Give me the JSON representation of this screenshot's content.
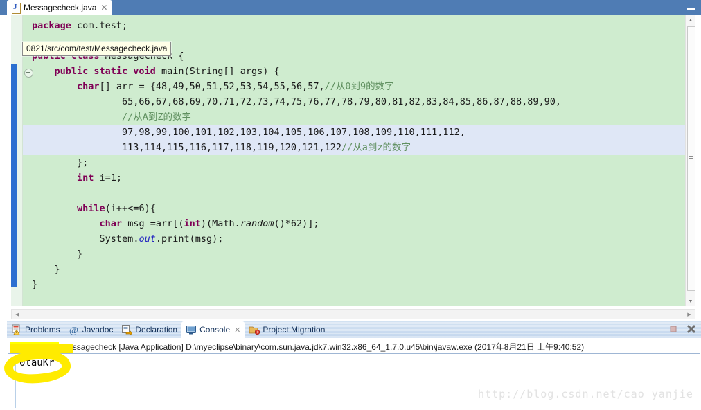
{
  "window": {
    "minimize_label": "–"
  },
  "editor": {
    "tab": {
      "icon": "java-file-icon",
      "label": "Messagecheck.java",
      "close": "✕"
    },
    "tooltip": "0821/src/com/test/Messagecheck.java",
    "code_lines": [
      {
        "indent": 0,
        "parts": [
          {
            "t": "kw",
            "s": "package"
          },
          {
            "t": "",
            "s": " com.test;"
          }
        ]
      },
      {
        "indent": 0,
        "parts": []
      },
      {
        "indent": 0,
        "parts": [
          {
            "t": "kw",
            "s": "public class"
          },
          {
            "t": "",
            "s": " Messagecheck {"
          }
        ]
      },
      {
        "indent": 1,
        "parts": [
          {
            "t": "kw",
            "s": "public static void"
          },
          {
            "t": "",
            "s": " main(String[] args) {"
          }
        ]
      },
      {
        "indent": 2,
        "parts": [
          {
            "t": "kw",
            "s": "char"
          },
          {
            "t": "",
            "s": "[] arr = {48,49,50,51,52,53,54,55,56,57,"
          },
          {
            "t": "cm",
            "s": "//从0到9的数字"
          }
        ]
      },
      {
        "indent": 4,
        "parts": [
          {
            "t": "",
            "s": "65,66,67,68,69,70,71,72,73,74,75,76,77,78,79,80,81,82,83,84,85,86,87,88,89,90,"
          }
        ]
      },
      {
        "indent": 4,
        "parts": [
          {
            "t": "cm",
            "s": "//从A到Z的数字"
          }
        ]
      },
      {
        "indent": 4,
        "parts": [
          {
            "t": "",
            "s": "97,98,99,100,101,102,103,104,105,106,107,108,109,110,111,112,"
          }
        ]
      },
      {
        "indent": 4,
        "parts": [
          {
            "t": "",
            "s": "113,114,115,116,117,118,119,120,121,122"
          },
          {
            "t": "cm",
            "s": "//从a到z的数字"
          }
        ]
      },
      {
        "indent": 2,
        "parts": [
          {
            "t": "",
            "s": "};"
          }
        ]
      },
      {
        "indent": 2,
        "parts": [
          {
            "t": "kw",
            "s": "int"
          },
          {
            "t": "",
            "s": " i=1;"
          }
        ]
      },
      {
        "indent": 0,
        "parts": []
      },
      {
        "indent": 2,
        "parts": [
          {
            "t": "kw",
            "s": "while"
          },
          {
            "t": "",
            "s": "(i++<=6){"
          }
        ]
      },
      {
        "indent": 3,
        "parts": [
          {
            "t": "kw",
            "s": "char"
          },
          {
            "t": "",
            "s": " msg =arr[("
          },
          {
            "t": "kw",
            "s": "int"
          },
          {
            "t": "",
            "s": ")(Math."
          },
          {
            "t": "st",
            "s": "random"
          },
          {
            "t": "",
            "s": "()*62)];"
          }
        ]
      },
      {
        "indent": 3,
        "parts": [
          {
            "t": "",
            "s": "System."
          },
          {
            "t": "fld",
            "s": "out"
          },
          {
            "t": "",
            "s": ".print(msg);"
          }
        ]
      },
      {
        "indent": 2,
        "parts": [
          {
            "t": "",
            "s": "}"
          }
        ]
      },
      {
        "indent": 1,
        "parts": [
          {
            "t": "",
            "s": "}"
          }
        ]
      },
      {
        "indent": 0,
        "parts": [
          {
            "t": "",
            "s": "}"
          }
        ]
      }
    ],
    "scrollbar": {
      "up_arrow": "▲",
      "down_arrow": "▼",
      "left_arrow": "◀",
      "right_arrow": "▶"
    }
  },
  "bottom_panel": {
    "tabs": [
      {
        "icon": "problems-icon",
        "label": "Problems",
        "active": false,
        "closable": false
      },
      {
        "icon": "javadoc-at-icon",
        "label": "Javadoc",
        "active": false,
        "closable": false
      },
      {
        "icon": "declaration-icon",
        "label": "Declaration",
        "active": false,
        "closable": false
      },
      {
        "icon": "console-icon",
        "label": "Console",
        "active": true,
        "closable": true
      },
      {
        "icon": "project-migration-icon",
        "label": "Project Migration",
        "active": false,
        "closable": false
      }
    ],
    "tab_close_glyph": "✕",
    "buttons": [
      {
        "icon": "terminate-icon"
      },
      {
        "icon": "remove-launch-icon"
      }
    ],
    "console": {
      "terminated_tag": "<terminated>",
      "run_info": " Messagecheck [Java Application] D:\\myeclipse\\binary\\com.sun.java.jdk7.win32.x86_64_1.7.0.u45\\bin\\javaw.exe (2017年8月21日 上午9:40:52)",
      "output": "0tauKr"
    }
  },
  "watermark": "http://blog.csdn.net/cao_yanjie",
  "colors": {
    "editor_background": "#cfeccf",
    "keyword": "#7f0055",
    "comment": "#5f8f5f",
    "field": "#2020c0",
    "highlight_line": "#dfe7f6",
    "marker_yellow": "#ffeb00",
    "title_blue": "#4f7cb4",
    "change_bar_blue": "#2c6fd0"
  }
}
